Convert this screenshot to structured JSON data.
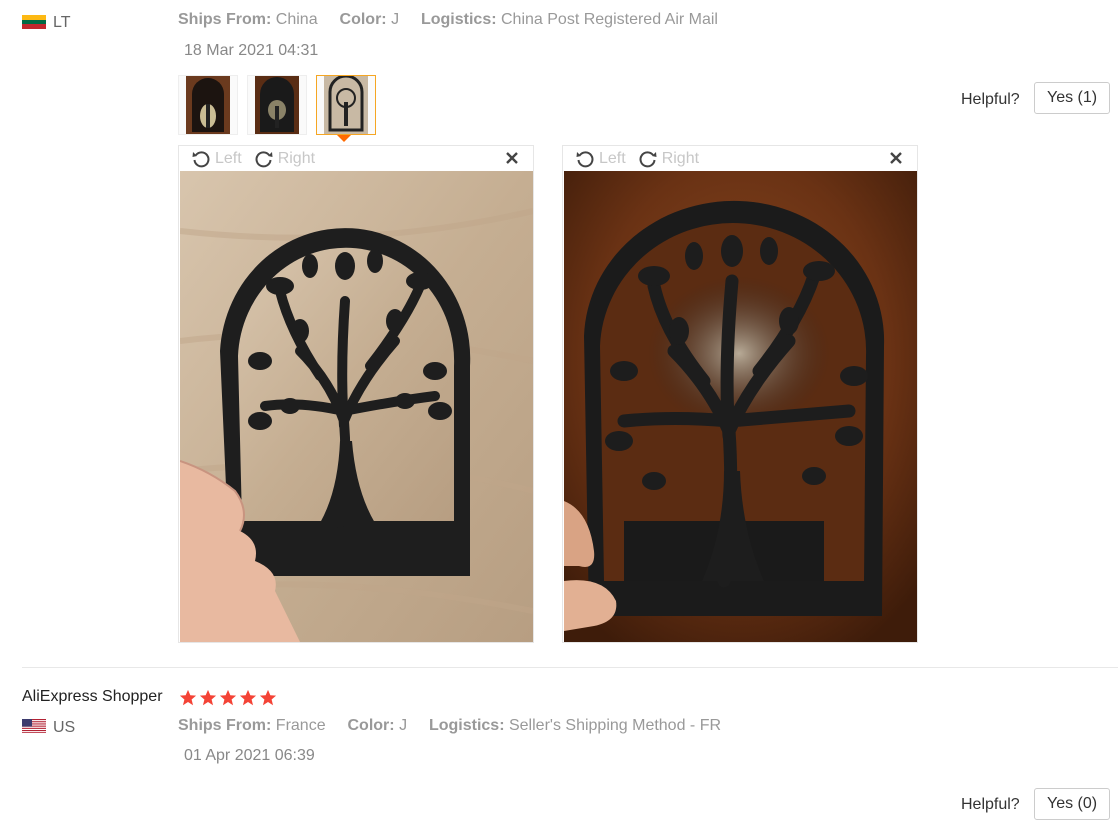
{
  "review1": {
    "country": "LT",
    "ships_from_label": "Ships From:",
    "ships_from_value": "China",
    "color_label": "Color:",
    "color_value": "J",
    "logistics_label": "Logistics:",
    "logistics_value": "China Post Registered Air Mail",
    "date": "18 Mar 2021 04:31",
    "helpful_label": "Helpful?",
    "yes_label": "Yes (1)",
    "viewers": [
      {
        "left_label": "Left",
        "right_label": "Right"
      },
      {
        "left_label": "Left",
        "right_label": "Right"
      }
    ]
  },
  "review2": {
    "name": "AliExpress Shopper",
    "rating": 5,
    "country": "US",
    "ships_from_label": "Ships From:",
    "ships_from_value": "France",
    "color_label": "Color:",
    "color_value": "J",
    "logistics_label": "Logistics:",
    "logistics_value": "Seller's Shipping Method - FR",
    "date": "01 Apr 2021 06:39",
    "helpful_label": "Helpful?",
    "yes_label": "Yes (0)"
  },
  "colors": {
    "star": "#f44336",
    "accent": "#ff6a00",
    "active_thumb_border": "#f5a623"
  },
  "icons": [
    "lithuania-flag-icon",
    "rotate-left-icon",
    "rotate-right-icon",
    "close-icon",
    "us-flag-icon",
    "star-icon"
  ]
}
